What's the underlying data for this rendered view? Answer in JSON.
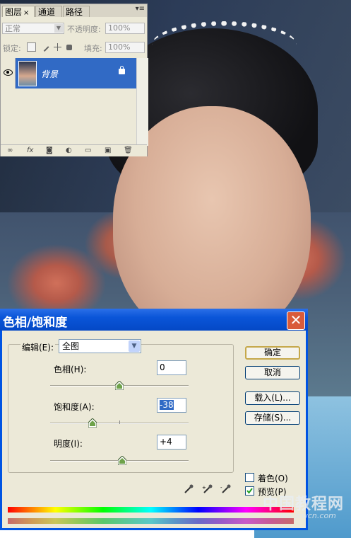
{
  "layers_panel": {
    "tabs": [
      {
        "label": "图层",
        "active": true,
        "close": "×"
      },
      {
        "label": "通道",
        "active": false
      },
      {
        "label": "路径",
        "active": false
      }
    ],
    "blend_mode": "正常",
    "opacity_label": "不透明度:",
    "opacity_value": "100%",
    "lock_label": "锁定:",
    "fill_label": "填充:",
    "fill_value": "100%",
    "layers": [
      {
        "name": "背景",
        "visible": true,
        "locked": true,
        "selected": true
      }
    ],
    "bottom_icons": [
      "link-icon",
      "fx-icon",
      "mask-icon",
      "adjustment-icon",
      "folder-icon",
      "new-layer-icon",
      "trash-icon"
    ]
  },
  "dialog": {
    "title": "色相/饱和度",
    "close": "✕",
    "edit_label": "编辑(E):",
    "edit_value": "全图",
    "hue": {
      "label": "色相(H):",
      "value": "0"
    },
    "saturation": {
      "label": "饱和度(A):",
      "value": "-38"
    },
    "lightness": {
      "label": "明度(I):",
      "value": "+4"
    },
    "buttons": {
      "ok": "确定",
      "cancel": "取消",
      "load": "载入(L)...",
      "save": "存储(S)..."
    },
    "colorize": {
      "label": "着色(O)",
      "checked": false
    },
    "preview": {
      "label": "预览(P)",
      "checked": true
    }
  },
  "watermark": {
    "text": "中国教程网",
    "url": "www.jcwcn.com"
  }
}
